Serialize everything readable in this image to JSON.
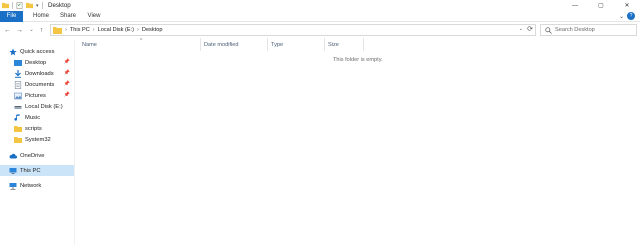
{
  "window": {
    "title": "Desktop",
    "minimize": "—",
    "maximize": "▢",
    "close": "✕"
  },
  "ribbon": {
    "tabs": [
      "File",
      "Home",
      "Share",
      "View"
    ],
    "expand": "⌄",
    "help": "?"
  },
  "navigation": {
    "back": "←",
    "forward": "→",
    "recent": "⌄",
    "up": "↑"
  },
  "address": {
    "crumbs": [
      "This PC",
      "Local Disk (E:)",
      "Desktop"
    ],
    "separator": "›",
    "dropdown": "⌄",
    "refresh": "⟳"
  },
  "search": {
    "placeholder": "Search Desktop"
  },
  "sidebar": {
    "items": [
      {
        "label": "Quick access",
        "icon": "star-icon"
      },
      {
        "label": "Desktop",
        "icon": "desktop-folder-icon",
        "pinned": true
      },
      {
        "label": "Downloads",
        "icon": "download-icon",
        "pinned": true
      },
      {
        "label": "Documents",
        "icon": "document-icon",
        "pinned": true
      },
      {
        "label": "Pictures",
        "icon": "picture-icon",
        "pinned": true
      },
      {
        "label": "Local Disk (E:)",
        "icon": "drive-icon"
      },
      {
        "label": "Music",
        "icon": "music-icon"
      },
      {
        "label": "scripts",
        "icon": "folder-icon"
      },
      {
        "label": "System32",
        "icon": "folder-icon"
      },
      {
        "label": "OneDrive",
        "icon": "cloud-icon"
      },
      {
        "label": "This PC",
        "icon": "computer-icon",
        "selected": true
      },
      {
        "label": "Network",
        "icon": "network-icon"
      }
    ]
  },
  "columns": [
    "Name",
    "Date modified",
    "Type",
    "Size"
  ],
  "content": {
    "empty_message": "This folder is empty."
  },
  "colors": {
    "accent": "#1a6fc6",
    "selection": "#cce4f7"
  }
}
